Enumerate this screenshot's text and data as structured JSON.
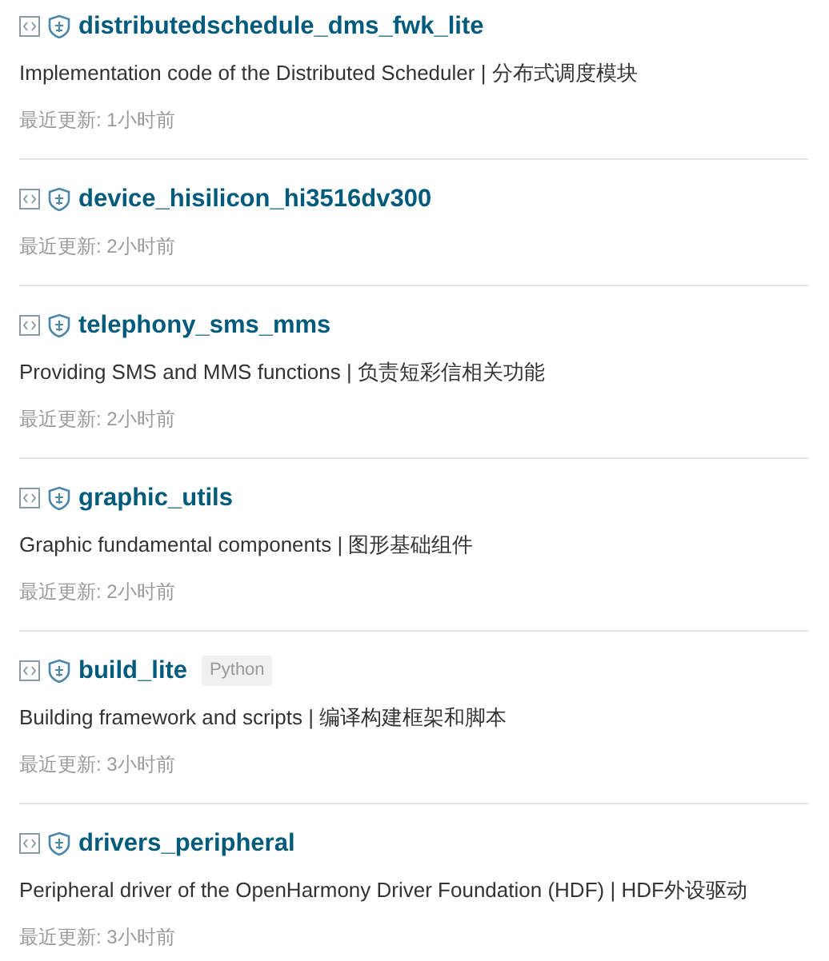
{
  "repos": [
    {
      "name": "distributedschedule_dms_fwk_lite",
      "description": "Implementation code of the Distributed Scheduler | 分布式调度模块",
      "updated": "最近更新: 1小时前"
    },
    {
      "name": "device_hisilicon_hi3516dv300",
      "updated": "最近更新: 2小时前"
    },
    {
      "name": "telephony_sms_mms",
      "description": "Providing SMS and MMS functions | 负责短彩信相关功能",
      "updated": "最近更新: 2小时前"
    },
    {
      "name": "graphic_utils",
      "description": "Graphic fundamental components | 图形基础组件",
      "updated": "最近更新: 2小时前"
    },
    {
      "name": "build_lite",
      "language": "Python",
      "description": "Building framework and scripts | 编译构建框架和脚本",
      "updated": "最近更新: 3小时前"
    },
    {
      "name": "drivers_peripheral",
      "description": "Peripheral driver of the OpenHarmony Driver Foundation (HDF) | HDF外设驱动",
      "updated": "最近更新: 3小时前"
    }
  ]
}
